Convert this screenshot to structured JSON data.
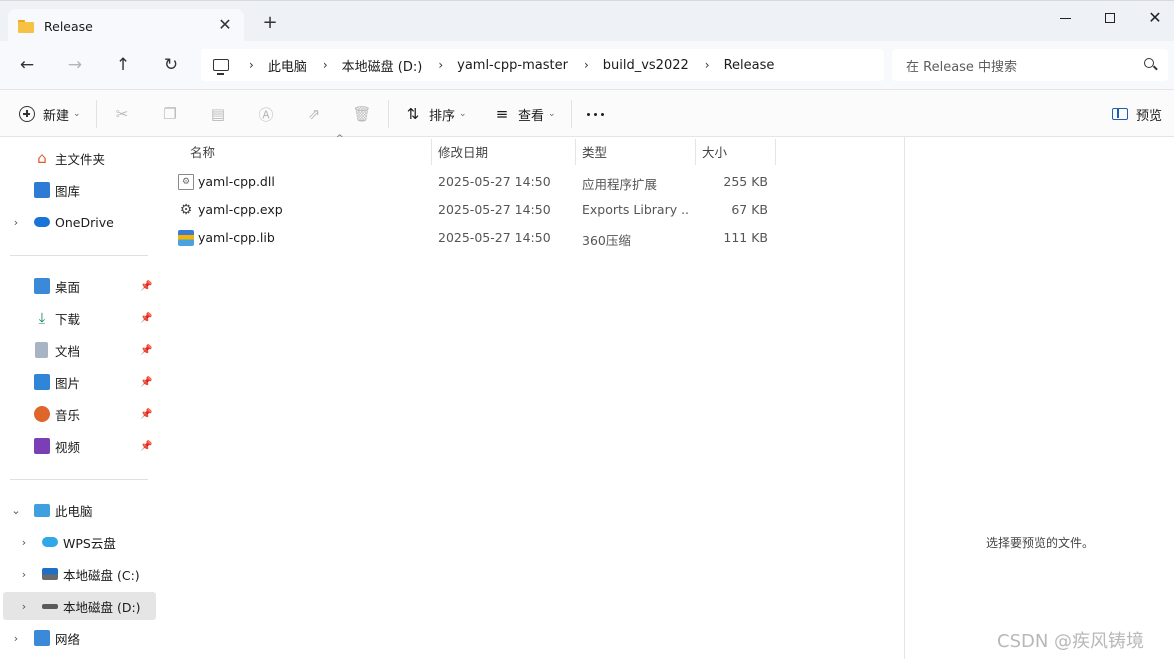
{
  "tab": {
    "title": "Release",
    "icon": "folder-icon"
  },
  "window": {
    "new_tab": "+",
    "close_tab": "✕"
  },
  "nav": {
    "breadcrumbs": [
      "此电脑",
      "本地磁盘 (D:)",
      "yaml-cpp-master",
      "build_vs2022",
      "Release"
    ],
    "search_placeholder": "在 Release 中搜索"
  },
  "commands": {
    "new_label": "新建",
    "sort_label": "排序",
    "view_label": "查看",
    "preview_label": "预览"
  },
  "sidebar": {
    "quick": [
      {
        "label": "主文件夹",
        "icon": "home-icon"
      },
      {
        "label": "图库",
        "icon": "gallery-icon"
      },
      {
        "label": "OneDrive",
        "icon": "onedrive-icon"
      }
    ],
    "pinned": [
      {
        "label": "桌面",
        "icon": "desktop-icon"
      },
      {
        "label": "下载",
        "icon": "download-icon"
      },
      {
        "label": "文档",
        "icon": "documents-icon"
      },
      {
        "label": "图片",
        "icon": "pictures-icon"
      },
      {
        "label": "音乐",
        "icon": "music-icon"
      },
      {
        "label": "视频",
        "icon": "videos-icon"
      }
    ],
    "computer": [
      {
        "label": "此电脑",
        "icon": "pc-icon"
      },
      {
        "label": "WPS云盘",
        "icon": "cloud-icon"
      },
      {
        "label": "本地磁盘 (C:)",
        "icon": "drive-c-icon"
      },
      {
        "label": "本地磁盘 (D:)",
        "icon": "drive-d-icon"
      },
      {
        "label": "网络",
        "icon": "network-icon"
      }
    ]
  },
  "columns": {
    "name": "名称",
    "date": "修改日期",
    "type": "类型",
    "size": "大小"
  },
  "files": [
    {
      "name": "yaml-cpp.dll",
      "date": "2025-05-27 14:50",
      "type": "应用程序扩展",
      "size": "255 KB"
    },
    {
      "name": "yaml-cpp.exp",
      "date": "2025-05-27 14:50",
      "type": "Exports Library ...",
      "size": "67 KB"
    },
    {
      "name": "yaml-cpp.lib",
      "date": "2025-05-27 14:50",
      "type": "360压缩",
      "size": "111 KB"
    }
  ],
  "preview": {
    "message": "选择要预览的文件。"
  },
  "watermark": "CSDN @疾风铸境",
  "colors": {
    "accent": "#1a5fb4",
    "selected_bg": "#e5e5e5",
    "folder": "#f6c244"
  }
}
